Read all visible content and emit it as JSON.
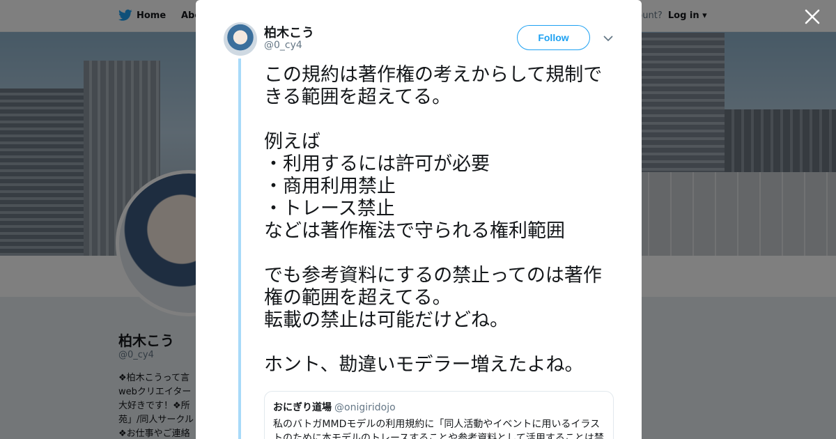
{
  "nav": {
    "home_label": "Home",
    "about_label": "Abo",
    "account_prompt": "ccount?",
    "login_label": "Log in"
  },
  "profile": {
    "name": "柏木こう",
    "handle": "@0_cy4",
    "bio_lines": [
      "❖柏木こうって言",
      "webクリエイター",
      "大好きです！❖所",
      "苑」/同人サークル",
      "❖お仕事やご連絡"
    ]
  },
  "tweet": {
    "author_name": "柏木こう",
    "author_handle": "@0_cy4",
    "follow_label": "Follow",
    "paragraphs": [
      "この規約は著作権の考えからして規制できる範囲を超えてる。",
      "例えば\n・利用するには許可が必要\n・商用利用禁止\n・トレース禁止\nなどは著作権法で守られる権利範囲",
      "でも参考資料にするの禁止ってのは著作権の範囲を超えてる。\n転載の禁止は可能だけどね。",
      "ホント、勘違いモデラー増えたよね。"
    ]
  },
  "quote": {
    "name": "おにぎり道場",
    "handle": "@onigiridojo",
    "text": "私のバトガMMDモデルの利用規約に「同人活動やイベントに用いるイラストのために本モデルのトレースすることや参考資料として活用することは禁"
  },
  "colors": {
    "twitter_blue": "#1da1f2",
    "thread_line": "#a8daf9"
  }
}
